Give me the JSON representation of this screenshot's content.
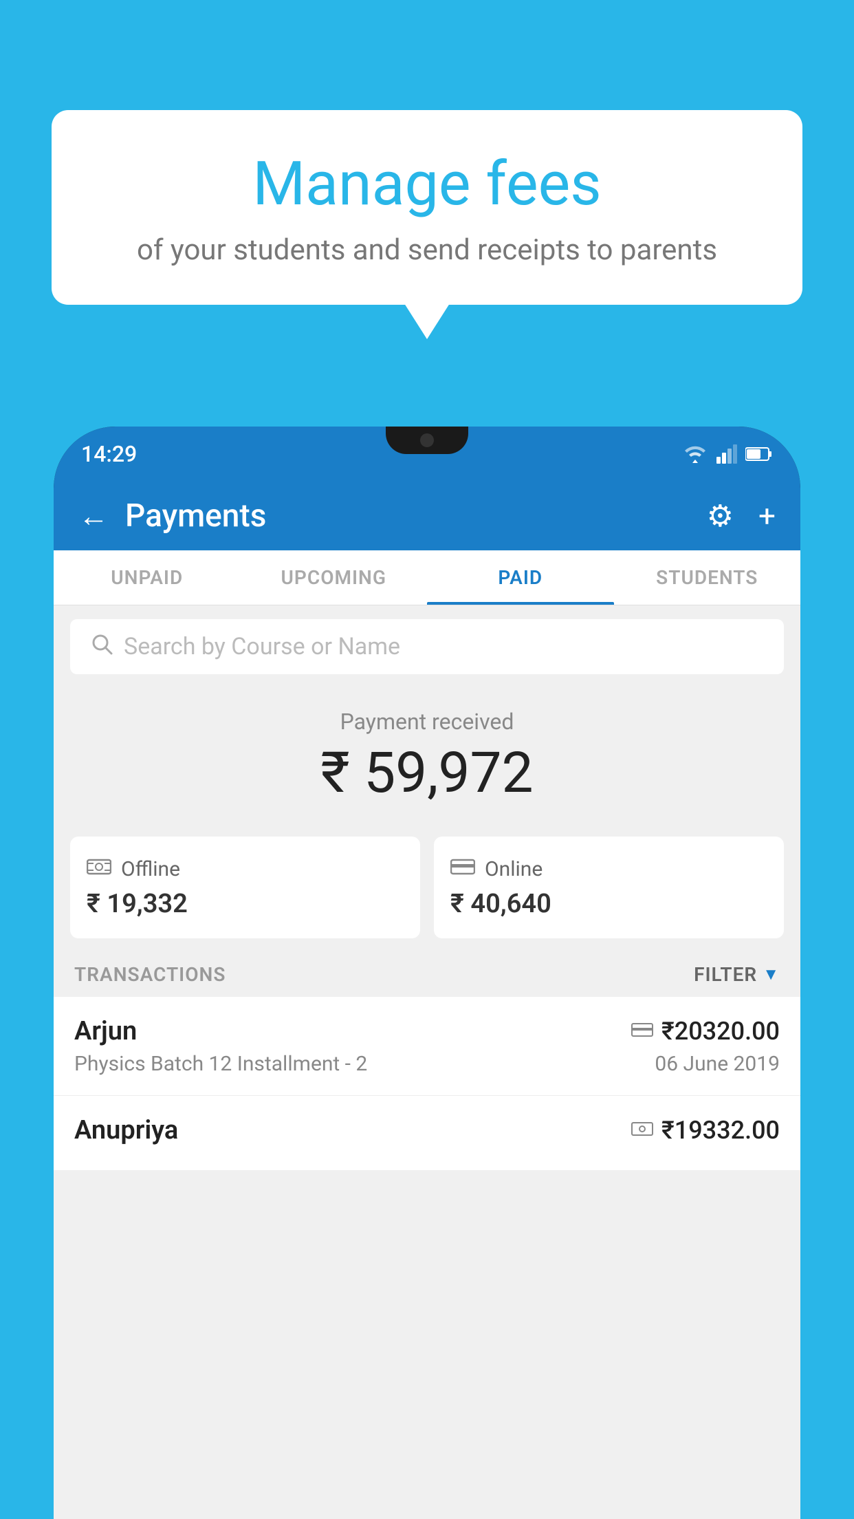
{
  "bubble": {
    "title": "Manage fees",
    "subtitle": "of your students and send receipts to parents"
  },
  "status_bar": {
    "time": "14:29"
  },
  "header": {
    "title": "Payments",
    "back_label": "←",
    "gear_label": "⚙",
    "plus_label": "+"
  },
  "tabs": [
    {
      "id": "unpaid",
      "label": "UNPAID",
      "active": false
    },
    {
      "id": "upcoming",
      "label": "UPCOMING",
      "active": false
    },
    {
      "id": "paid",
      "label": "PAID",
      "active": true
    },
    {
      "id": "students",
      "label": "STUDENTS",
      "active": false
    }
  ],
  "search": {
    "placeholder": "Search by Course or Name"
  },
  "payment_summary": {
    "received_label": "Payment received",
    "total_amount": "₹ 59,972",
    "offline_label": "Offline",
    "offline_amount": "₹ 19,332",
    "online_label": "Online",
    "online_amount": "₹ 40,640"
  },
  "transactions": {
    "header_label": "TRANSACTIONS",
    "filter_label": "FILTER",
    "rows": [
      {
        "name": "Arjun",
        "course": "Physics Batch 12 Installment - 2",
        "date": "06 June 2019",
        "amount": "₹20320.00",
        "payment_type": "card"
      },
      {
        "name": "Anupriya",
        "course": "",
        "date": "",
        "amount": "₹19332.00",
        "payment_type": "cash"
      }
    ]
  }
}
